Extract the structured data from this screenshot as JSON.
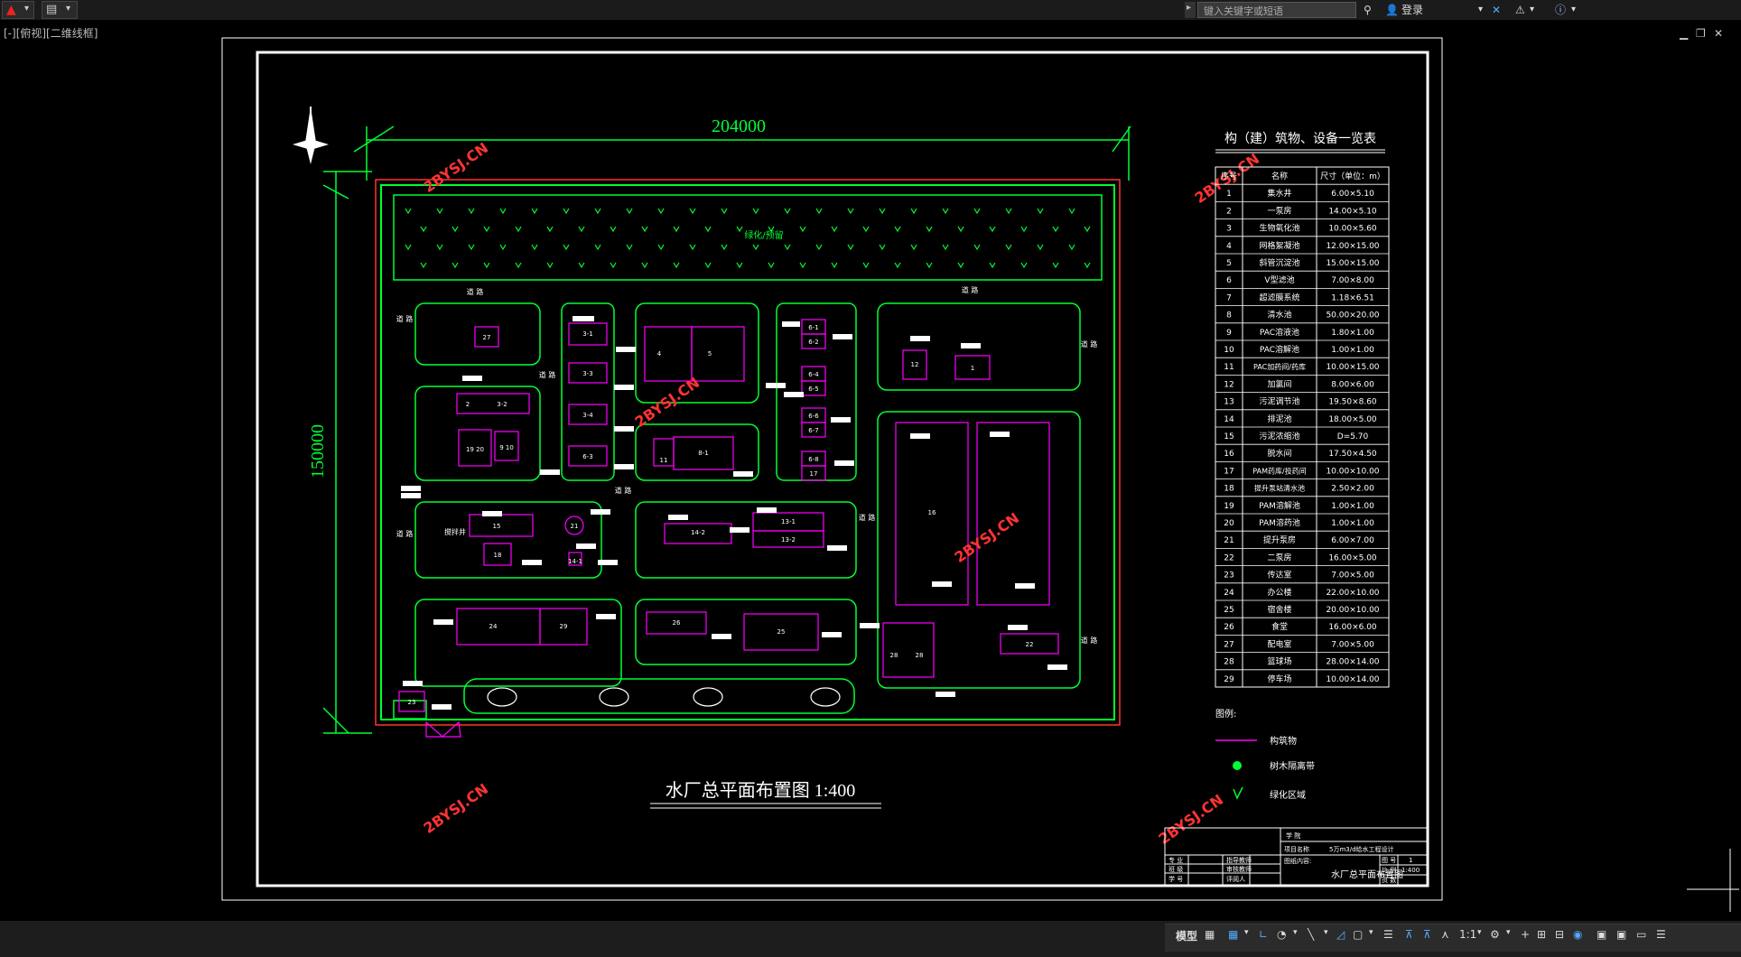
{
  "app": {
    "search_placeholder": "键入关键字或短语",
    "login_label": "登录",
    "view_label": "[-][俯视][二维线框]"
  },
  "drawing": {
    "dim_width": "204000",
    "dim_height": "150000",
    "title": "水厂总平面布置图 1:400",
    "watermark": "2BYSJ.CN",
    "green_label": "绿化/预留",
    "road_label": "道 路",
    "mixer_label": "搅拌井",
    "buildings": [
      {
        "id": "27",
        "label": "27"
      },
      {
        "id": "3-1",
        "label": "3-1"
      },
      {
        "id": "4",
        "label": "4"
      },
      {
        "id": "5",
        "label": "5"
      },
      {
        "id": "6-1",
        "label": "6-1"
      },
      {
        "id": "6-2",
        "label": "6-2"
      },
      {
        "id": "12",
        "label": "12"
      },
      {
        "id": "1",
        "label": "1"
      },
      {
        "id": "2",
        "label": "2"
      },
      {
        "id": "3-2",
        "label": "3-2"
      },
      {
        "id": "3-3",
        "label": "3-3"
      },
      {
        "id": "3-4",
        "label": "3-4"
      },
      {
        "id": "6-3",
        "label": "6-3"
      },
      {
        "id": "6-4",
        "label": "6-4"
      },
      {
        "id": "6-5",
        "label": "6-5"
      },
      {
        "id": "6-6",
        "label": "6-6"
      },
      {
        "id": "6-7",
        "label": "6-7"
      },
      {
        "id": "6-8",
        "label": "6-8"
      },
      {
        "id": "17",
        "label": "17"
      },
      {
        "id": "19",
        "label": "19 20"
      },
      {
        "id": "9",
        "label": "9 10"
      },
      {
        "id": "11",
        "label": "11"
      },
      {
        "id": "8-1",
        "label": "8-1"
      },
      {
        "id": "16",
        "label": "16"
      },
      {
        "id": "15",
        "label": "15"
      },
      {
        "id": "21",
        "label": "21"
      },
      {
        "id": "18",
        "label": "18"
      },
      {
        "id": "14-1",
        "label": "14-1"
      },
      {
        "id": "14-2",
        "label": "14-2"
      },
      {
        "id": "13-1",
        "label": "13-1"
      },
      {
        "id": "13-2",
        "label": "13-2"
      },
      {
        "id": "24",
        "label": "24"
      },
      {
        "id": "29",
        "label": "29"
      },
      {
        "id": "26",
        "label": "26"
      },
      {
        "id": "25",
        "label": "25"
      },
      {
        "id": "28a",
        "label": "28"
      },
      {
        "id": "28b",
        "label": "28"
      },
      {
        "id": "22",
        "label": "22"
      },
      {
        "id": "23",
        "label": "23"
      }
    ]
  },
  "table": {
    "title": "构（建）筑物、设备一览表",
    "headers": [
      "序号",
      "名称",
      "尺寸（单位：m）"
    ],
    "rows": [
      [
        "1",
        "集水井",
        "6.00×5.10"
      ],
      [
        "2",
        "一泵房",
        "14.00×5.10"
      ],
      [
        "3",
        "生物氧化池",
        "10.00×5.60"
      ],
      [
        "4",
        "网格絮凝池",
        "12.00×15.00"
      ],
      [
        "5",
        "斜管沉淀池",
        "15.00×15.00"
      ],
      [
        "6",
        "V型滤池",
        "7.00×8.00"
      ],
      [
        "7",
        "超滤膜系统",
        "1.18×6.51"
      ],
      [
        "8",
        "清水池",
        "50.00×20.00"
      ],
      [
        "9",
        "PAC溶液池",
        "1.80×1.00"
      ],
      [
        "10",
        "PAC溶解池",
        "1.00×1.00"
      ],
      [
        "11",
        "PAC加药间/药库",
        "10.00×15.00"
      ],
      [
        "12",
        "加氯间",
        "8.00×6.00"
      ],
      [
        "13",
        "污泥调节池",
        "19.50×8.60"
      ],
      [
        "14",
        "排泥池",
        "18.00×5.00"
      ],
      [
        "15",
        "污泥浓缩池",
        "D=5.70"
      ],
      [
        "16",
        "脱水间",
        "17.50×4.50"
      ],
      [
        "17",
        "PAM药库/投药间",
        "10.00×10.00"
      ],
      [
        "18",
        "提升泵站清水池",
        "2.50×2.00"
      ],
      [
        "19",
        "PAM溶解池",
        "1.00×1.00"
      ],
      [
        "20",
        "PAM溶药池",
        "1.00×1.00"
      ],
      [
        "21",
        "提升泵房",
        "6.00×7.00"
      ],
      [
        "22",
        "二泵房",
        "16.00×5.00"
      ],
      [
        "23",
        "传达室",
        "7.00×5.00"
      ],
      [
        "24",
        "办公楼",
        "22.00×10.00"
      ],
      [
        "25",
        "宿舍楼",
        "20.00×10.00"
      ],
      [
        "26",
        "食堂",
        "16.00×6.00"
      ],
      [
        "27",
        "配电室",
        "7.00×5.00"
      ],
      [
        "28",
        "篮球场",
        "28.00×14.00"
      ],
      [
        "29",
        "停车场",
        "10.00×14.00"
      ]
    ]
  },
  "legend": {
    "title": "图例:",
    "items": [
      "构筑物",
      "树木隔离带",
      "绿化区域"
    ]
  },
  "title_block": {
    "school_label": "学 院",
    "project_label": "项目名称",
    "project_value": "5万m3/d给水工程设计",
    "drawing_content_label": "图纸内容:",
    "drawing_name": "水厂总平面布置图",
    "major_label": "专 业",
    "class_label": "班 级",
    "student_label": "学 号",
    "teacher_label": "指导教师",
    "checker_label": "审核教师",
    "reviewer_label": "评阅人",
    "sheet_label": "图 号",
    "sheet_value": "1",
    "scale_label": "比 例",
    "scale_value": "1:400",
    "page_label": "页 数"
  },
  "status": {
    "model_label": "模型",
    "scale_label": "1:1"
  },
  "colors": {
    "green": "#00ff33",
    "magenta": "#ff00ff",
    "white": "#ffffff",
    "red": "#ff3333",
    "watermark": "#ff3333"
  }
}
